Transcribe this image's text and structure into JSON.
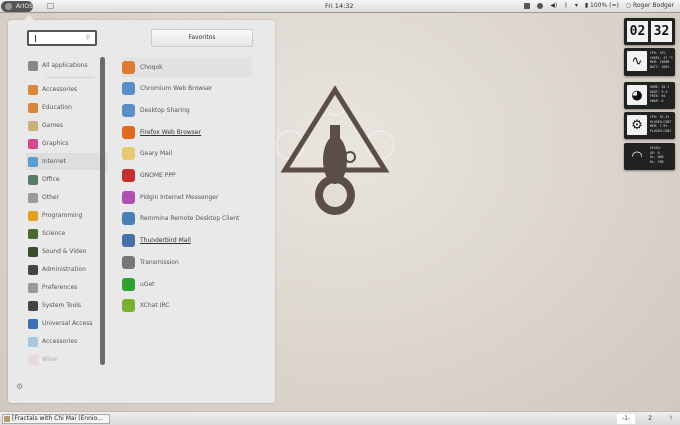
{
  "topbar": {
    "menu_label": "ArIOS",
    "clock": "Fri 14:32",
    "battery": "100% (=)",
    "user": "Roger Bodger"
  },
  "launcher": {
    "search": {
      "value": "",
      "placeholder": ""
    },
    "favorites_label": "Favoritos",
    "categories": [
      {
        "label": "All applications",
        "color": "#888888"
      },
      {
        "label": "Accessories",
        "color": "#d9883a"
      },
      {
        "label": "Education",
        "color": "#d9883a"
      },
      {
        "label": "Games",
        "color": "#c9b27a"
      },
      {
        "label": "Graphics",
        "color": "#d04a8a"
      },
      {
        "label": "Internet",
        "color": "#5a9fd4"
      },
      {
        "label": "Office",
        "color": "#5a7d6a"
      },
      {
        "label": "Other",
        "color": "#9a9a9a"
      },
      {
        "label": "Programming",
        "color": "#e0a020"
      },
      {
        "label": "Science",
        "color": "#4a6a30"
      },
      {
        "label": "Sound & Video",
        "color": "#3a4a2a"
      },
      {
        "label": "Administration",
        "color": "#444444"
      },
      {
        "label": "Preferences",
        "color": "#999999"
      },
      {
        "label": "System Tools",
        "color": "#444444"
      },
      {
        "label": "Universal Access",
        "color": "#3a70b8"
      },
      {
        "label": "Accessories",
        "color": "#a8c8e0"
      },
      {
        "label": "Wine",
        "color": "#e8c8c0"
      }
    ],
    "selected_category": "Internet",
    "apps": [
      {
        "label": "Choqok",
        "color": "#e07a30"
      },
      {
        "label": "Chromium Web Browser",
        "color": "#5a8ec8"
      },
      {
        "label": "Desktop Sharing",
        "color": "#5a8ec8"
      },
      {
        "label": "Firefox Web Browser",
        "color": "#e06a20",
        "underline": true
      },
      {
        "label": "Geary Mail",
        "color": "#e8c870"
      },
      {
        "label": "GNOME PPP",
        "color": "#c83030"
      },
      {
        "label": "Pidgin Internet Messenger",
        "color": "#b050b0"
      },
      {
        "label": "Remmina Remote Desktop Client",
        "color": "#4a80b8"
      },
      {
        "label": "Thunderbird Mail",
        "color": "#4a70a8",
        "underline": true
      },
      {
        "label": "Transmission",
        "color": "#777777"
      },
      {
        "label": "uGet",
        "color": "#30a030"
      },
      {
        "label": "XChat IRC",
        "color": "#7ab030"
      }
    ]
  },
  "widgets": {
    "clock": {
      "hours": "02",
      "minutes": "32"
    },
    "system": [
      "CPU: 33%",
      "CORE1: 47 °C",
      "MEM: 1568M",
      "BATT: 100%"
    ],
    "disk": [
      "HOME: 26.1",
      "ROOT: 9.4",
      "FREE: 64",
      "SWAP: 0"
    ],
    "settings": [
      "CPU: 33.4%",
      "PLUGIN-CONT",
      "MEM: 7.9%",
      "PLUGIN-CONT"
    ],
    "network": [
      "ESSID:",
      "AP: 0",
      "UL: 0KB",
      "DL: 7KB"
    ]
  },
  "taskbar": {
    "task": "[Fractals with Chi Mai (Ennio...",
    "workspaces": [
      "-1-",
      "2",
      "!"
    ]
  }
}
